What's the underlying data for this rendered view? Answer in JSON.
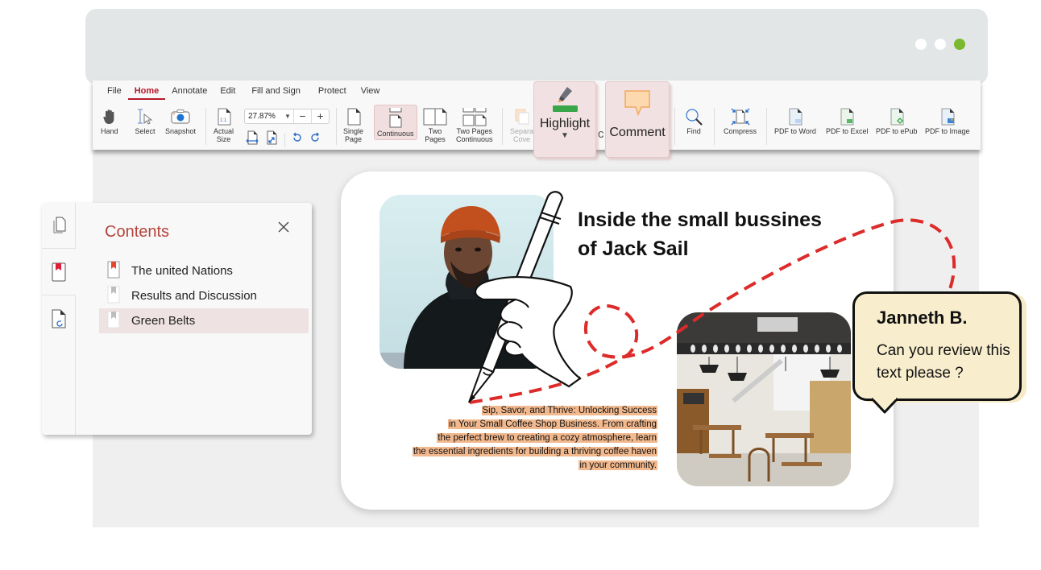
{
  "window": {
    "controls": [
      {
        "name": "window-dot-1",
        "color": "#ffffff"
      },
      {
        "name": "window-dot-2",
        "color": "#ffffff"
      },
      {
        "name": "window-dot-3",
        "color": "#7cb82f"
      }
    ]
  },
  "menu": {
    "items": [
      "File",
      "Home",
      "Annotate",
      "Edit",
      "Fill and Sign",
      "Protect",
      "View"
    ],
    "active": "Home"
  },
  "toolbar": {
    "hand": "Hand",
    "select": "Select",
    "snapshot": "Snapshot",
    "actual_size_line1": "Actual",
    "actual_size_line2": "Size",
    "actual_size_badge": "1:1",
    "zoom_value": "27.87%",
    "zoom_out": "−",
    "zoom_in": "+",
    "single_page_line1": "Single",
    "single_page_line2": "Page",
    "continuous": "Continuous",
    "two_pages_line1": "Two",
    "two_pages_line2": "Pages",
    "two_pages_cont_line1": "Two Pages",
    "two_pages_cont_line2": "Continuous",
    "separate_cover_line1": "Separa",
    "separate_cover_line2": "Cove",
    "hidden_fragment": "c",
    "find": "Find",
    "compress": "Compress",
    "pdf_to_word": "PDF to Word",
    "pdf_to_excel": "PDF to Excel",
    "pdf_to_epub": "PDF to ePub",
    "pdf_to_image": "PDF to Image",
    "selected_view": "Continuous"
  },
  "floating_tools": {
    "highlight": "Highlight",
    "comment": "Comment",
    "highlight_color": "#3aa64a",
    "comment_color": "#f8c98f"
  },
  "contents_panel": {
    "title": "Contents",
    "items": [
      {
        "label": "The united Nations",
        "bookmark_color": "#e8452f"
      },
      {
        "label": "Results and Discussion",
        "bookmark_color": "#bdbdbd"
      },
      {
        "label": "Green Belts",
        "bookmark_color": "#bdbdbd",
        "selected": true
      }
    ]
  },
  "page": {
    "headline": "Inside the small bussines of Jack Sail",
    "headline_line1": "Inside the small bussines",
    "headline_line2": "of Jack Sail",
    "paragraph_lines": [
      "Sip, Savor, and Thrive: Unlocking Success",
      "in Your Small Coffee Shop Business. From crafting",
      "the perfect brew to creating a cozy atmosphere, learn",
      "the essential ingredients for building a thriving coffee haven",
      "in your community."
    ],
    "highlight_color": "#f3b98e",
    "annotation_color": "#dd2a2a",
    "photo_person": "Portrait of man in orange beanie and black turtleneck",
    "photo_cafe": "Coffee shop interior"
  },
  "comment": {
    "author": "Janneth B.",
    "text": "Can you review this text please ?"
  }
}
